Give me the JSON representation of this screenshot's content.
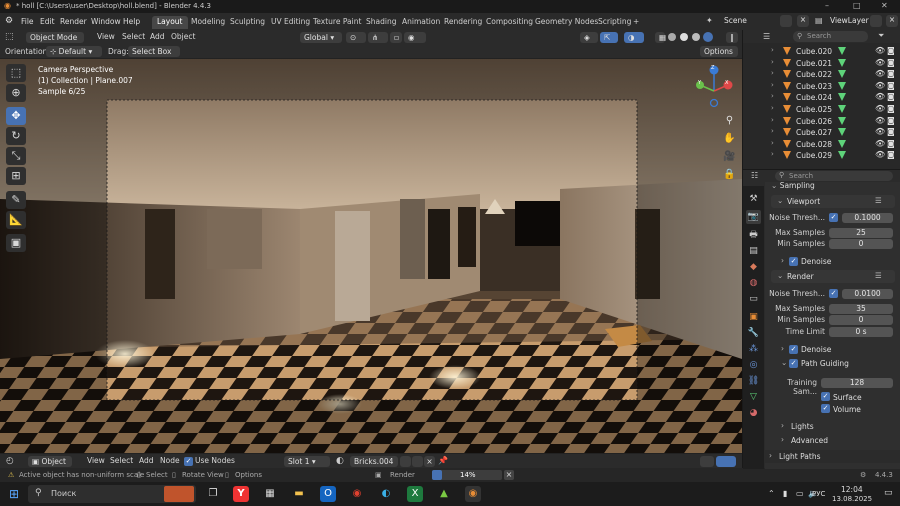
{
  "window": {
    "title": "* holl [C:\\Users\\user\\Desktop\\holl.blend] - Blender 4.4.3",
    "controls": [
      "–",
      "□",
      "✕"
    ]
  },
  "menu": {
    "items": [
      "File",
      "Edit",
      "Render",
      "Window",
      "Help"
    ],
    "workspaces": [
      "Layout",
      "Modeling",
      "Sculpting",
      "UV Editing",
      "Texture Paint",
      "Shading",
      "Animation",
      "Rendering",
      "Compositing",
      "Geometry Nodes",
      "Scripting"
    ],
    "active_workspace": "Layout",
    "add_tab": "+",
    "scene": "Scene",
    "view_layer": "ViewLayer"
  },
  "viewport_header": {
    "mode": "Object Mode",
    "menus": [
      "View",
      "Select",
      "Add",
      "Object"
    ],
    "transform_orientation": "Global",
    "orientation_label": "Orientation:",
    "orientation_value": "Default",
    "drag_label": "Drag:",
    "drag_value": "Select Box",
    "options": "Options"
  },
  "viewport": {
    "overlay_lines": [
      "Camera Perspective",
      "(1) Collection | Plane.007",
      "Sample 6/25"
    ]
  },
  "axis_gizmo": {
    "x": "X",
    "y": "Y",
    "z": "Z"
  },
  "bottom_header": {
    "editor_mode": "Object",
    "menus": [
      "View",
      "Select",
      "Add",
      "Node"
    ],
    "use_nodes_label": "Use Nodes",
    "slot": "Slot 1",
    "material": "Bricks.004"
  },
  "status": {
    "warning": "Active object has non-uniform scale",
    "select": "Select",
    "rotate": "Rotate View",
    "options": "Options",
    "render_label": "Render",
    "render_progress_percent": 14,
    "render_progress_text": "14%",
    "version": "4.4.3"
  },
  "outliner": {
    "search_placeholder": "Search",
    "items": [
      "Cube.020",
      "Cube.021",
      "Cube.022",
      "Cube.023",
      "Cube.024",
      "Cube.025",
      "Cube.026",
      "Cube.027",
      "Cube.028",
      "Cube.029"
    ]
  },
  "properties": {
    "search_placeholder": "Search",
    "section": "Sampling",
    "viewport": {
      "title": "Viewport",
      "noise_label": "Noise Thresh...",
      "noise_value": "0.1000",
      "max_label": "Max Samples",
      "max_value": "25",
      "min_label": "Min Samples",
      "min_value": "0",
      "denoise": "Denoise"
    },
    "render": {
      "title": "Render",
      "noise_label": "Noise Thresh...",
      "noise_value": "0.0100",
      "max_label": "Max Samples",
      "max_value": "35",
      "min_label": "Min Samples",
      "min_value": "0",
      "time_label": "Time Limit",
      "time_value": "0 s",
      "denoise": "Denoise",
      "path_guiding": "Path Guiding",
      "training_label": "Training Sam...",
      "training_value": "128",
      "surface": "Surface",
      "volume": "Volume"
    },
    "lights": "Lights",
    "advanced": "Advanced",
    "light_paths": "Light Paths"
  },
  "taskbar": {
    "search_placeholder": "Поиск",
    "language": "РУС",
    "time": "12:04",
    "date": "13.08.2025"
  },
  "colors": {
    "accent": "#4772b3",
    "object_orange": "#e88d36",
    "mesh_green": "#5ed37a"
  }
}
